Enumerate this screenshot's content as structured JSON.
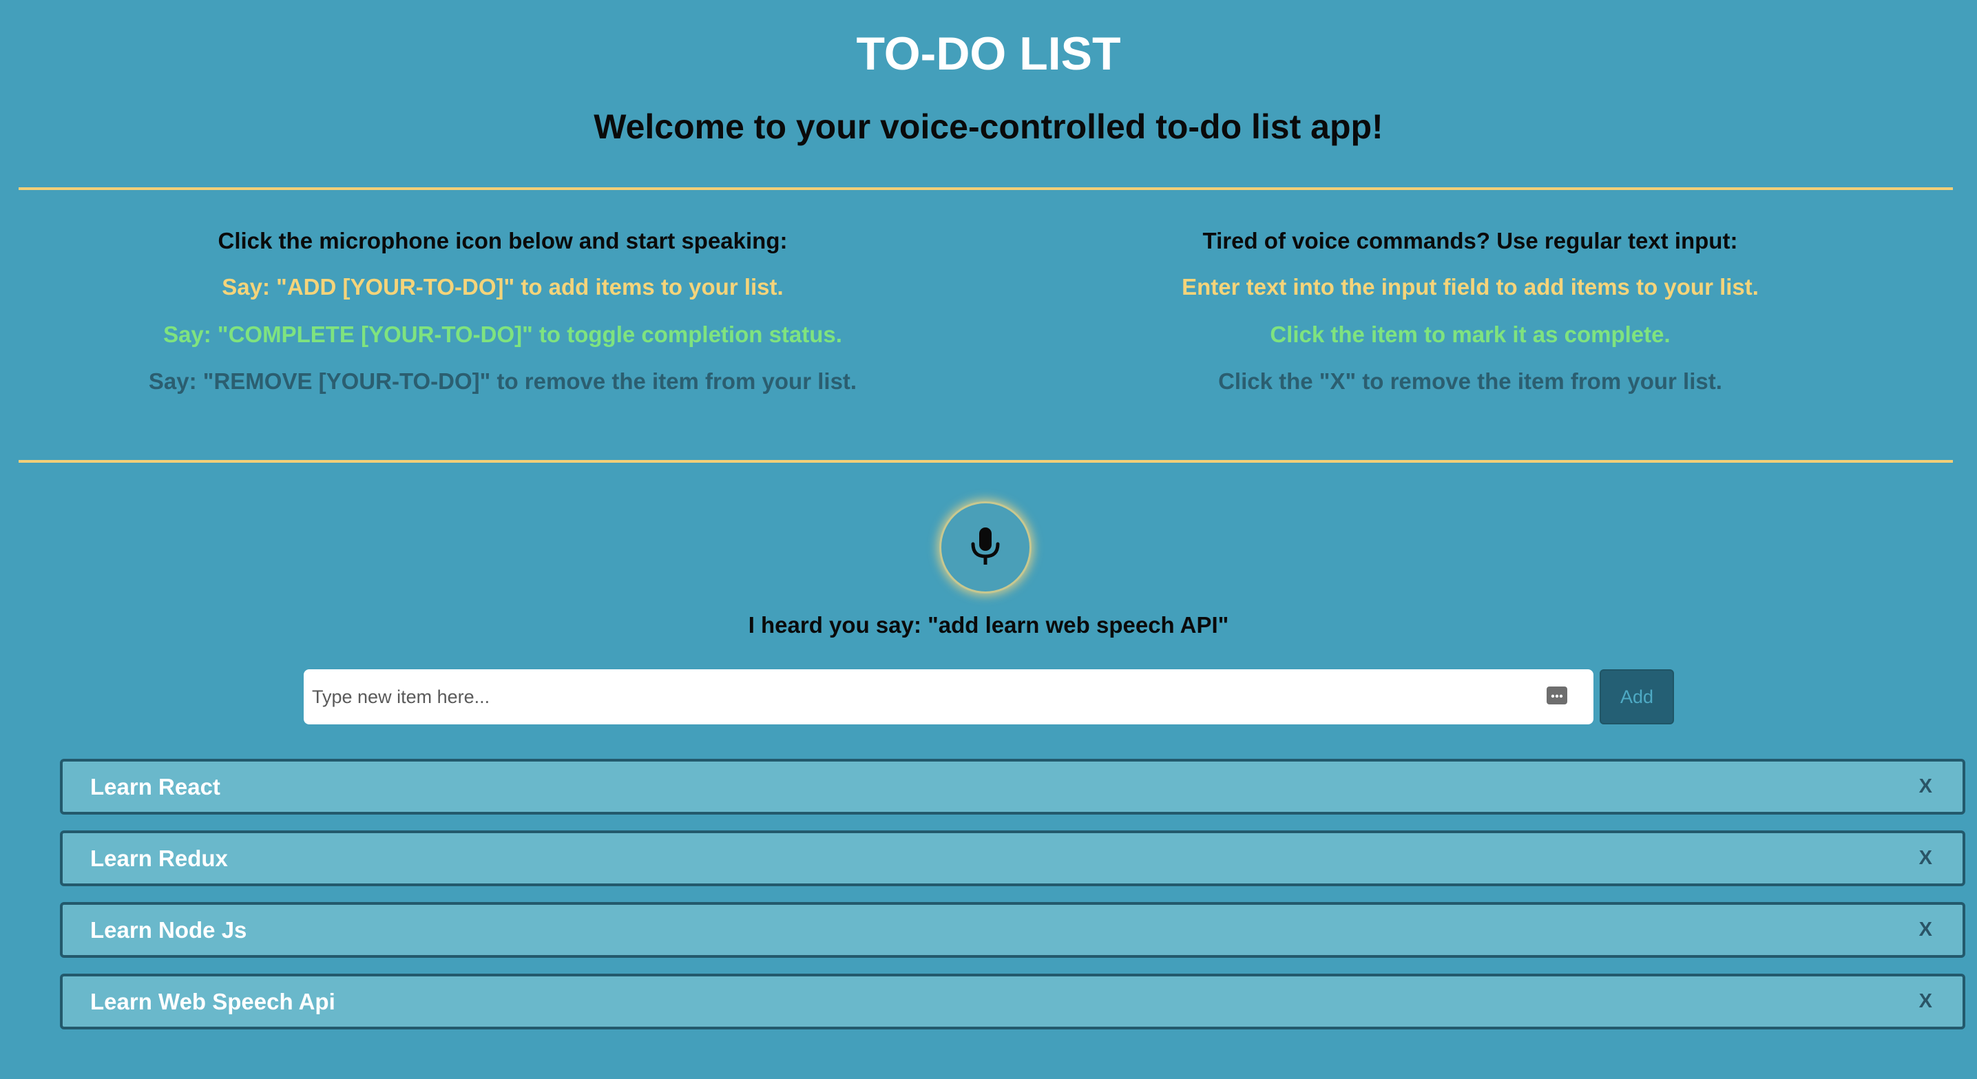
{
  "header": {
    "title": "TO-DO LIST",
    "subtitle": "Welcome to your voice-controlled to-do list app!"
  },
  "voice_instructions": {
    "heading": "Click the microphone icon below and start speaking:",
    "add": "Say: \"ADD [YOUR-TO-DO]\" to add items to your list.",
    "complete": "Say: \"COMPLETE [YOUR-TO-DO]\" to toggle completion status.",
    "remove": "Say: \"REMOVE [YOUR-TO-DO]\" to remove the item from your list."
  },
  "text_instructions": {
    "heading": "Tired of voice commands? Use regular text input:",
    "add": "Enter text into the input field to add items to your list.",
    "complete": "Click the item to mark it as complete.",
    "remove": "Click the \"X\" to remove the item from your list."
  },
  "mic": {
    "icon": "microphone-icon",
    "heard_text": "I heard you say: \"add learn web speech API\""
  },
  "input": {
    "value": "",
    "placeholder": "Type new item here...",
    "add_label": "Add"
  },
  "todos": [
    {
      "label": "Learn React",
      "remove_label": "X"
    },
    {
      "label": "Learn Redux",
      "remove_label": "X"
    },
    {
      "label": "Learn Node Js",
      "remove_label": "X"
    },
    {
      "label": "Learn Web Speech Api",
      "remove_label": "X"
    }
  ],
  "colors": {
    "background": "#449fbb",
    "divider": "#f2cf78",
    "add_instruction": "#f5d47a",
    "complete_instruction": "#7fe37f",
    "remove_instruction": "#2b5e70",
    "todo_item": "#6ab8cb",
    "todo_border": "#23596c"
  }
}
